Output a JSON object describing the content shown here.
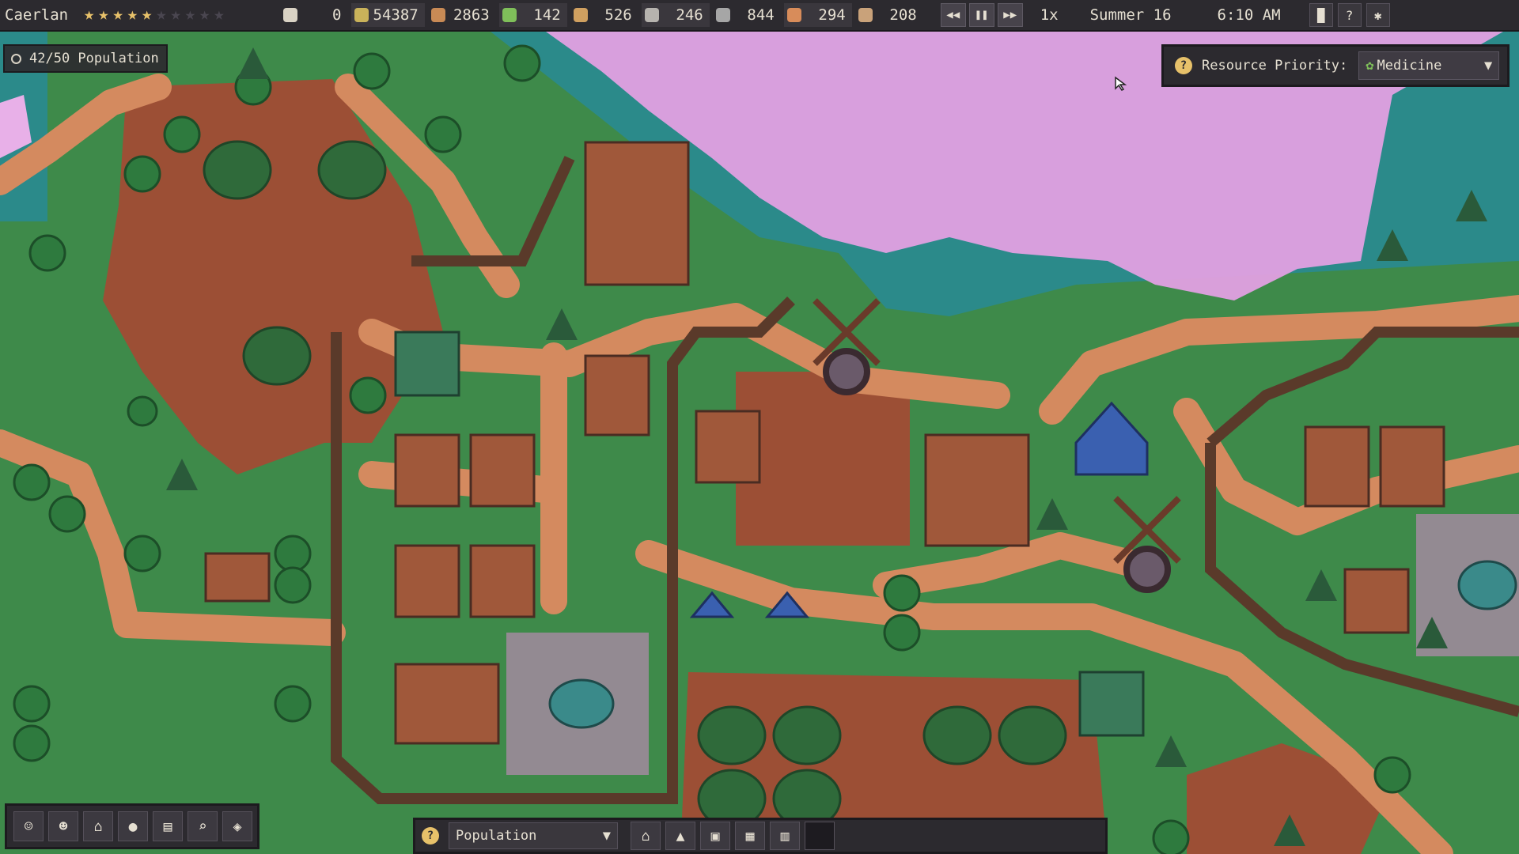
{
  "topbar": {
    "town_name": "Caerlan",
    "stars_filled": 5,
    "stars_total": 10,
    "resources": [
      {
        "icon": "happiness-icon",
        "value": "0",
        "color": "#d9d2c4"
      },
      {
        "icon": "gold-icon",
        "value": "54387",
        "color": "#c9b25a"
      },
      {
        "icon": "wood-icon",
        "value": "2863",
        "color": "#c88a55"
      },
      {
        "icon": "medicine-icon",
        "value": "142",
        "color": "#7fbf5a"
      },
      {
        "icon": "plank-icon",
        "value": "526",
        "color": "#d0a060"
      },
      {
        "icon": "stone-icon",
        "value": "246",
        "color": "#b6b3ae"
      },
      {
        "icon": "tool-icon",
        "value": "844",
        "color": "#a6a6a6"
      },
      {
        "icon": "food-icon",
        "value": "294",
        "color": "#d88c5a"
      },
      {
        "icon": "ore-icon",
        "value": "208",
        "color": "#c9a27a"
      }
    ],
    "speed_buttons": [
      {
        "icon": "rewind-icon",
        "glyph": "◀◀"
      },
      {
        "icon": "pause-icon",
        "glyph": "❚❚"
      },
      {
        "icon": "fast-forward-icon",
        "glyph": "▶▶"
      }
    ],
    "speed": "1x",
    "season": "Summer 16",
    "time": "6:10 AM"
  },
  "population": {
    "label": "42/50 Population"
  },
  "priority": {
    "label": "Resource Priority:",
    "value": "Medicine"
  },
  "build_bar": {
    "category": "Population",
    "buildings": [
      {
        "icon": "house-icon",
        "glyph": "⌂",
        "locked": false
      },
      {
        "icon": "tent-icon",
        "glyph": "▲",
        "locked": false
      },
      {
        "icon": "cabin-icon",
        "glyph": "▣",
        "locked": false
      },
      {
        "icon": "manor-icon",
        "glyph": "▦",
        "locked": false
      },
      {
        "icon": "townhouse-icon",
        "glyph": "▥",
        "locked": false
      },
      {
        "icon": "locked-building-icon",
        "glyph": "",
        "locked": true
      }
    ]
  },
  "tools": [
    {
      "icon": "villager-icon",
      "glyph": "☺"
    },
    {
      "icon": "workers-icon",
      "glyph": "☻"
    },
    {
      "icon": "buildings-icon",
      "glyph": "⌂"
    },
    {
      "icon": "resources-icon",
      "glyph": "●"
    },
    {
      "icon": "book-icon",
      "glyph": "▤"
    },
    {
      "icon": "magnify-icon",
      "glyph": "⌕"
    },
    {
      "icon": "map-icon",
      "glyph": "◈"
    }
  ],
  "colors": {
    "grass": "#3e8a4a",
    "dirt_path": "#d48a5f",
    "dirt_field": "#9c4f35",
    "water": "#2b8a8a",
    "fog": "#e2a0e2",
    "ui_panel": "#2c2a2f",
    "star_filled": "#e7c16a",
    "star_empty": "#4a4650"
  }
}
